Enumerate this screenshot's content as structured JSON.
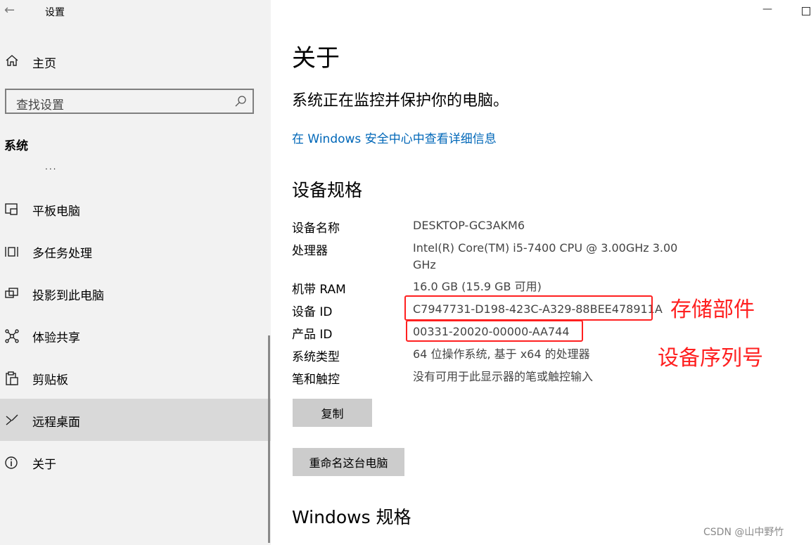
{
  "window": {
    "title": "设置",
    "minimize": "—"
  },
  "sidebar": {
    "home_label": "主页",
    "search_placeholder": "查找设置",
    "section_title": "系统",
    "ellipsis": "...",
    "items": [
      {
        "label": "平板电脑",
        "icon": "tablet-icon"
      },
      {
        "label": "多任务处理",
        "icon": "multitasking-icon"
      },
      {
        "label": "投影到此电脑",
        "icon": "project-icon"
      },
      {
        "label": "体验共享",
        "icon": "share-icon"
      },
      {
        "label": "剪贴板",
        "icon": "clipboard-icon"
      },
      {
        "label": "远程桌面",
        "icon": "remote-desktop-icon",
        "selected": true
      },
      {
        "label": "关于",
        "icon": "info-icon"
      }
    ]
  },
  "main": {
    "title": "关于",
    "status_text": "系统正在监控并保护你的电脑。",
    "security_link": "在 Windows 安全中心中查看详细信息",
    "spec_heading": "设备规格",
    "specs": [
      {
        "label": "设备名称",
        "value": "DESKTOP-GC3AKM6"
      },
      {
        "label": "处理器",
        "value": "Intel(R) Core(TM) i5-7400 CPU @ 3.00GHz   3.00 GHz"
      },
      {
        "label": "机带 RAM",
        "value": "16.0 GB (15.9 GB 可用)"
      },
      {
        "label": "设备 ID",
        "value": "C7947731-D198-423C-A329-88BEE478911A"
      },
      {
        "label": "产品 ID",
        "value": "00331-20020-00000-AA744"
      },
      {
        "label": "系统类型",
        "value": "64 位操作系统, 基于 x64 的处理器"
      },
      {
        "label": "笔和触控",
        "value": "没有可用于此显示器的笔或触控输入"
      }
    ],
    "copy_button": "复制",
    "rename_button": "重命名这台电脑",
    "windows_spec_heading": "Windows 规格"
  },
  "annotations": {
    "device_id_note": "存储部件",
    "product_id_note": "设备序列号",
    "color": "#ff2020"
  },
  "watermark": "CSDN @山中野竹",
  "colors": {
    "sidebar_bg": "#f2f2f2",
    "selected_bg": "#d9d9d9",
    "link": "#0067b8",
    "button_bg": "#cccccc"
  }
}
